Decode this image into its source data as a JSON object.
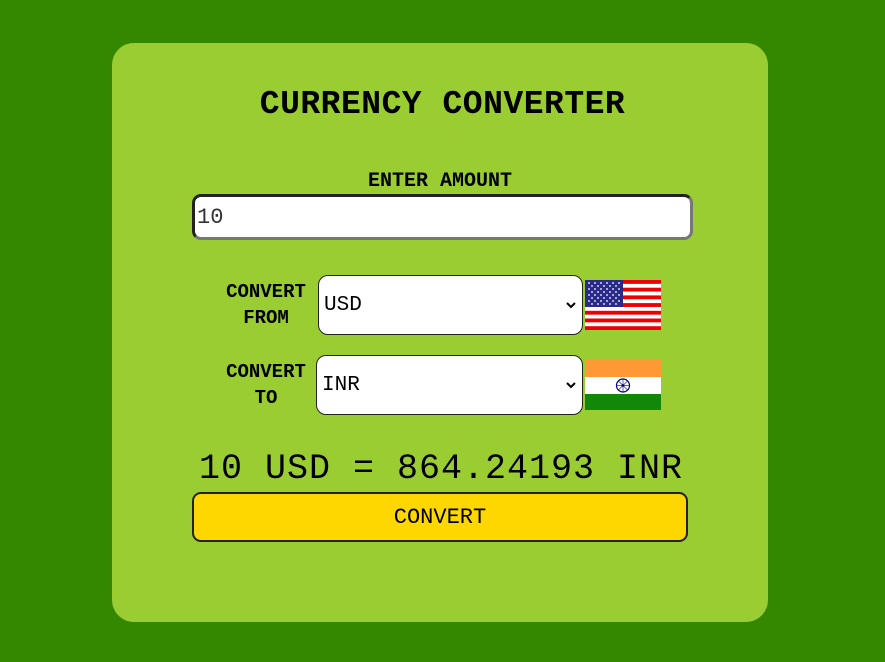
{
  "title": "CURRENCY CONVERTER",
  "amount": {
    "label": "ENTER AMOUNT",
    "value": "10"
  },
  "from": {
    "label_line1": "CONVERT",
    "label_line2": "FROM",
    "selected": "USD",
    "flag": "us-flag-icon"
  },
  "to": {
    "label_line1": "CONVERT",
    "label_line2": "TO",
    "selected": "INR",
    "flag": "india-flag-icon"
  },
  "result": "10 USD = 864.24193 INR",
  "convert_button": "CONVERT",
  "colors": {
    "background": "#338800",
    "card": "#9acd32",
    "button": "#ffd700"
  }
}
